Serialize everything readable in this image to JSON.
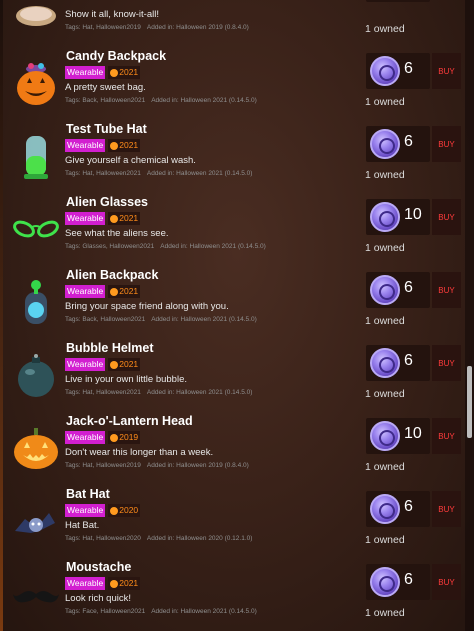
{
  "items": [
    {
      "id": "top",
      "name": "",
      "wearable": "",
      "year": "",
      "desc": "Show it all, know-it-all!",
      "tags": "Tags: Hat, Halloween2019",
      "added": "Added in: Halloween 2019 (0.8.4.0)",
      "price": "",
      "buy": "",
      "owned": "1 owned",
      "icon": "crystal-ball-icon"
    },
    {
      "id": "candy-backpack",
      "name": "Candy Backpack",
      "wearable": "Wearable",
      "year": "2021",
      "desc": "A pretty sweet bag.",
      "tags": "Tags: Back, Halloween2021",
      "added": "Added in: Halloween 2021 (0.14.5.0)",
      "price": "6",
      "buy": "BUY",
      "owned": "1 owned",
      "icon": "pumpkin-bucket-icon"
    },
    {
      "id": "test-tube-hat",
      "name": "Test Tube Hat",
      "wearable": "Wearable",
      "year": "2021",
      "desc": "Give yourself a chemical wash.",
      "tags": "Tags: Hat, Halloween2021",
      "added": "Added in: Halloween 2021 (0.14.5.0)",
      "price": "6",
      "buy": "BUY",
      "owned": "1 owned",
      "icon": "test-tube-icon"
    },
    {
      "id": "alien-glasses",
      "name": "Alien Glasses",
      "wearable": "Wearable",
      "year": "2021",
      "desc": "See what the aliens see.",
      "tags": "Tags: Glasses, Halloween2021",
      "added": "Added in: Halloween 2021 (0.14.5.0)",
      "price": "10",
      "buy": "BUY",
      "owned": "1 owned",
      "icon": "alien-glasses-icon"
    },
    {
      "id": "alien-backpack",
      "name": "Alien Backpack",
      "wearable": "Wearable",
      "year": "2021",
      "desc": "Bring your space friend along with you.",
      "tags": "Tags: Back, Halloween2021",
      "added": "Added in: Halloween 2021 (0.14.5.0)",
      "price": "6",
      "buy": "BUY",
      "owned": "1 owned",
      "icon": "alien-backpack-icon"
    },
    {
      "id": "bubble-helmet",
      "name": "Bubble Helmet",
      "wearable": "Wearable",
      "year": "2021",
      "desc": "Live in your own little bubble.",
      "tags": "Tags: Hat, Halloween2021",
      "added": "Added in: Halloween 2021 (0.14.5.0)",
      "price": "6",
      "buy": "BUY",
      "owned": "1 owned",
      "icon": "bubble-helmet-icon"
    },
    {
      "id": "jack-o-lantern-head",
      "name": "Jack-o'-Lantern Head",
      "wearable": "Wearable",
      "year": "2019",
      "desc": "Don't wear this longer than a week.",
      "tags": "Tags: Hat, Halloween2019",
      "added": "Added in: Halloween 2019 (0.8.4.0)",
      "price": "10",
      "buy": "BUY",
      "owned": "1 owned",
      "icon": "jack-o-lantern-icon"
    },
    {
      "id": "bat-hat",
      "name": "Bat Hat",
      "wearable": "Wearable",
      "year": "2020",
      "desc": "Hat Bat.",
      "tags": "Tags: Hat, Halloween2020",
      "added": "Added in: Halloween 2020 (0.12.1.0)",
      "price": "6",
      "buy": "BUY",
      "owned": "1 owned",
      "icon": "bat-icon"
    },
    {
      "id": "moustache",
      "name": "Moustache",
      "wearable": "Wearable",
      "year": "2021",
      "desc": "Look rich quick!",
      "tags": "Tags: Face, Halloween2021",
      "added": "Added in: Halloween 2021 (0.14.5.0)",
      "price": "6",
      "buy": "BUY",
      "owned": "1 owned",
      "icon": "moustache-icon"
    }
  ],
  "colors": {
    "wearable_badge": "#d21fd0",
    "year_badge_text": "#ff8c1a",
    "buy_text": "#ff3b3b",
    "coin": "#9a83ee",
    "background": "#3a2219"
  }
}
